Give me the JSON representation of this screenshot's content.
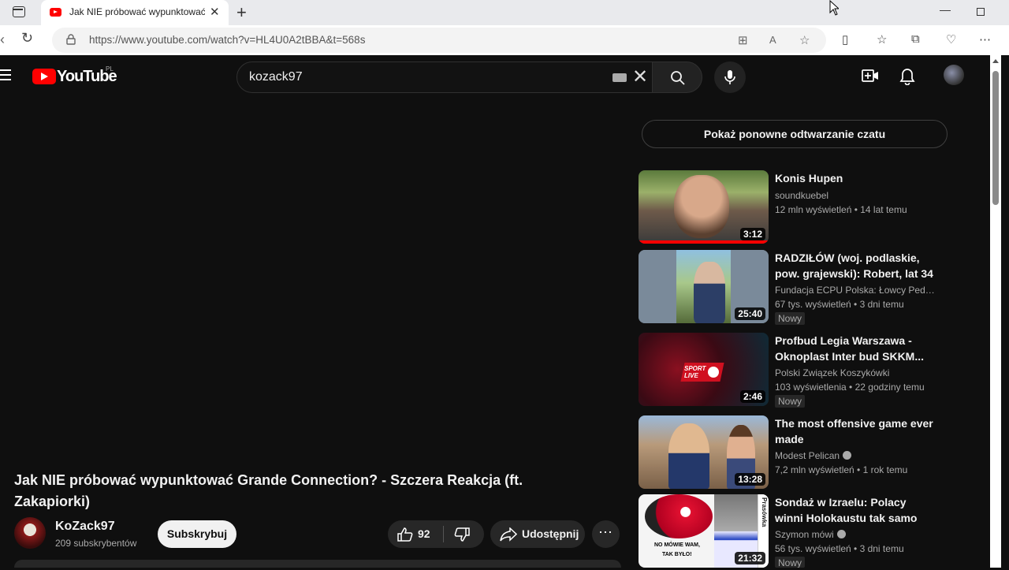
{
  "browser": {
    "tab_title": "Jak NIE próbować wypunktować",
    "url": "https://www.youtube.com/watch?v=HL4U0A2tBBA&t=568s"
  },
  "header": {
    "logo_text": "YouTube",
    "country_code": "PL",
    "search_value": "kozack97"
  },
  "video": {
    "title": "Jak NIE próbować wypunktować Grande Connection? - Szczera Reakcja (ft. Zakapiorki)",
    "channel_name": "KoZack97",
    "subscribers": "209 subskrybentów",
    "subscribe_label": "Subskrybuj",
    "likes": "92",
    "share_label": "Udostępnij"
  },
  "sidebar": {
    "chat_replay_label": "Pokaż ponowne odtwarzanie czatu",
    "recommendations": [
      {
        "title": "Konis Hupen",
        "channel": "soundkuebel",
        "views": "12 mln wyświetleń",
        "age": "14 lat temu",
        "duration": "3:12",
        "badge": ""
      },
      {
        "title": "RADZIŁÓW (woj. podlaskie, pow. grajewski): Robert, lat 34",
        "channel": "Fundacja ECPU Polska: Łowcy Pedo...",
        "views": "67 tys. wyświetleń",
        "age": "3 dni temu",
        "duration": "25:40",
        "badge": "Nowy"
      },
      {
        "title": "Profbud Legia Warszawa - Oknoplast Inter bud SKKM...",
        "channel": "Polski Związek Koszykówki",
        "views": "103 wyświetlenia",
        "age": "22 godziny temu",
        "duration": "2:46",
        "badge": "Nowy"
      },
      {
        "title": "The most offensive game ever made",
        "channel": "Modest Pelican",
        "views": "7,2 mln wyświetleń",
        "age": "1 rok temu",
        "duration": "13:28",
        "badge": ""
      },
      {
        "title": "Sondaż w Izraelu: Polacy winni Holokaustu tak samo jak...",
        "channel": "Szymon mówi",
        "views": "56 tys. wyświetleń",
        "age": "3 dni temu",
        "duration": "21:32",
        "badge": "Nowy"
      }
    ],
    "thumb_texts": {
      "sport": "SPORT",
      "live": "LIVE",
      "meme1": "NO MÓWIE WAM,",
      "meme2": "TAK BYŁO!",
      "side": "Prasówka"
    }
  },
  "colors": {
    "bg": "#0f0f0f",
    "accent": "#ff0000",
    "text": "#f1f1f1",
    "secondary": "#aaaaaa"
  }
}
